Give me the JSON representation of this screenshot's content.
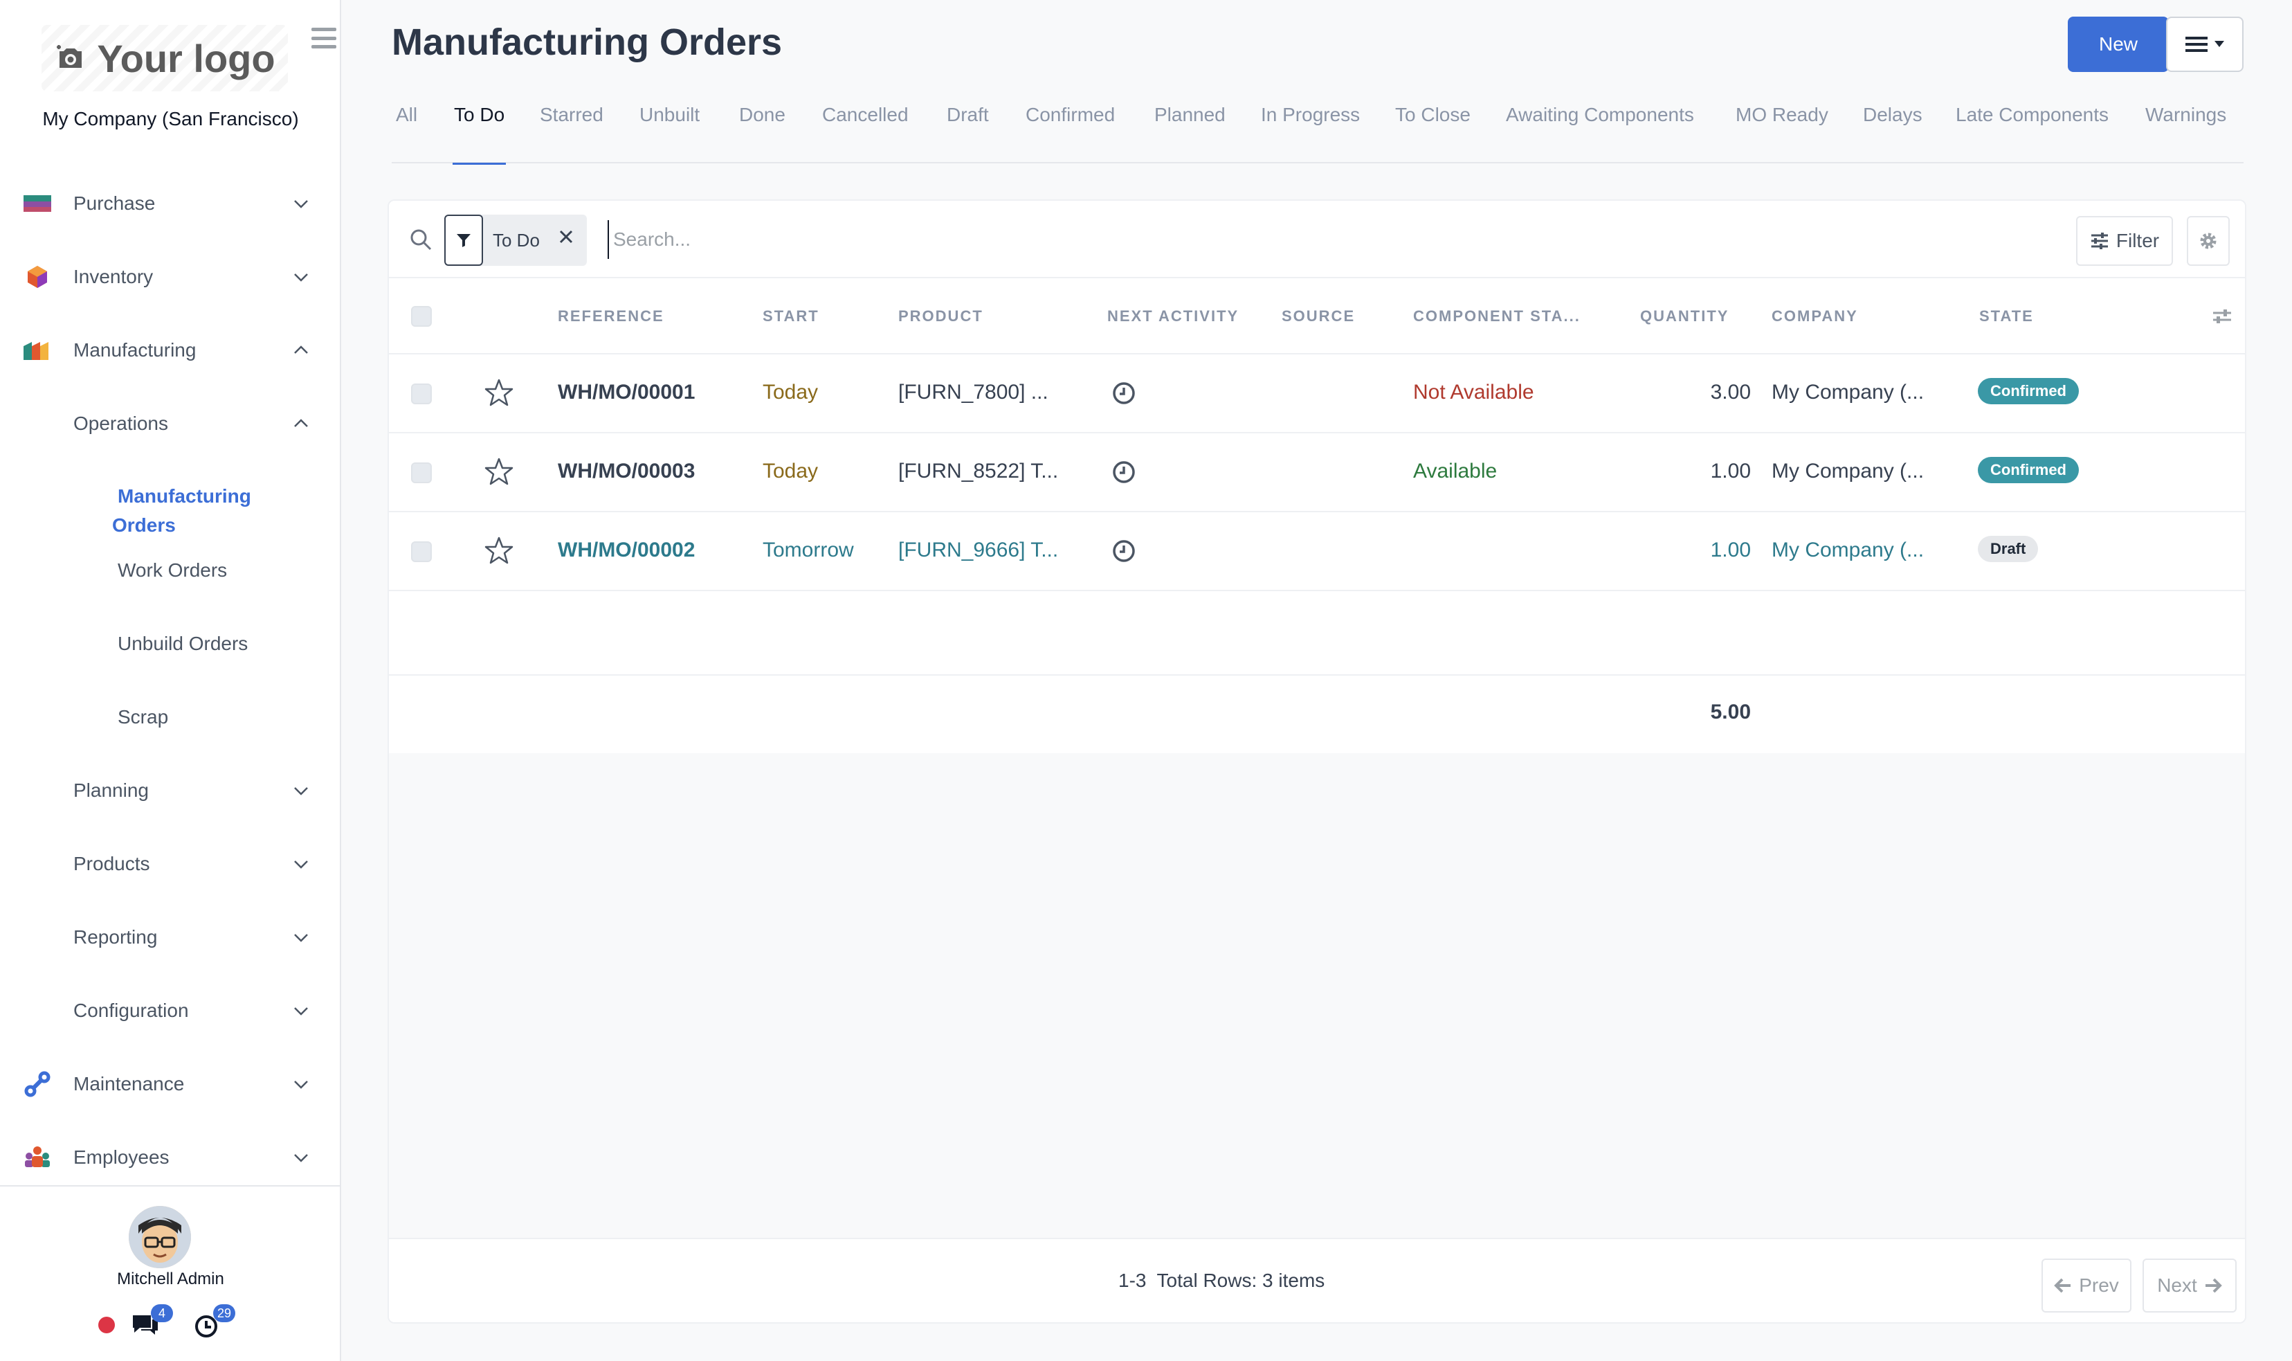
{
  "sidebar": {
    "logo_text": "Your logo",
    "company": "My Company (San Francisco)",
    "apps": [
      {
        "label": "Purchase"
      },
      {
        "label": "Inventory"
      },
      {
        "label": "Manufacturing"
      }
    ],
    "operations": {
      "label": "Operations",
      "items": [
        {
          "label": "Manufacturing Orders"
        },
        {
          "label": "Work Orders"
        },
        {
          "label": "Unbuild Orders"
        },
        {
          "label": "Scrap"
        }
      ]
    },
    "sub_sections": [
      {
        "label": "Planning"
      },
      {
        "label": "Products"
      },
      {
        "label": "Reporting"
      },
      {
        "label": "Configuration"
      }
    ],
    "more_apps": [
      {
        "label": "Maintenance"
      },
      {
        "label": "Employees"
      }
    ],
    "user": {
      "name": "Mitchell Admin",
      "messages_badge": "4",
      "activities_badge": "29"
    }
  },
  "header": {
    "title": "Manufacturing Orders",
    "new_label": "New"
  },
  "tabs": [
    {
      "label": "All"
    },
    {
      "label": "To Do"
    },
    {
      "label": "Starred"
    },
    {
      "label": "Unbuilt"
    },
    {
      "label": "Done"
    },
    {
      "label": "Cancelled"
    },
    {
      "label": "Draft"
    },
    {
      "label": "Confirmed"
    },
    {
      "label": "Planned"
    },
    {
      "label": "In Progress"
    },
    {
      "label": "To Close"
    },
    {
      "label": "Awaiting Components"
    },
    {
      "label": "MO Ready"
    },
    {
      "label": "Delays"
    },
    {
      "label": "Late Components"
    },
    {
      "label": "Warnings"
    }
  ],
  "active_tab": "To Do",
  "search": {
    "facet": "To Do",
    "placeholder": "Search...",
    "filter_label": "Filter"
  },
  "table": {
    "columns": [
      "REFERENCE",
      "START",
      "PRODUCT",
      "NEXT ACTIVITY",
      "SOURCE",
      "COMPONENT STA...",
      "QUANTITY",
      "COMPANY",
      "STATE"
    ],
    "rows": [
      {
        "reference": "WH/MO/00001",
        "start": "Today",
        "product": "[FURN_7800] ...",
        "source": "",
        "component_status": "Not Available",
        "quantity": "3.00",
        "company": "My Company (...",
        "state": "Confirmed"
      },
      {
        "reference": "WH/MO/00003",
        "start": "Today",
        "product": "[FURN_8522] T...",
        "source": "",
        "component_status": "Available",
        "quantity": "1.00",
        "company": "My Company (...",
        "state": "Confirmed"
      },
      {
        "reference": "WH/MO/00002",
        "start": "Tomorrow",
        "product": "[FURN_9666] T...",
        "source": "",
        "component_status": "",
        "quantity": "1.00",
        "company": "My Company (...",
        "state": "Draft"
      }
    ],
    "total_quantity": "5.00"
  },
  "pager": {
    "range": "1-3",
    "summary": "Total Rows: 3 items",
    "prev_label": "Prev",
    "next_label": "Next"
  },
  "colors": {
    "accent": "#3c6ed6",
    "confirmed_badge": "#3a98a6",
    "not_available": "#b03a2e",
    "available": "#2d7a3e",
    "today": "#8a6a1b",
    "draft_row": "#2d7a8c"
  }
}
